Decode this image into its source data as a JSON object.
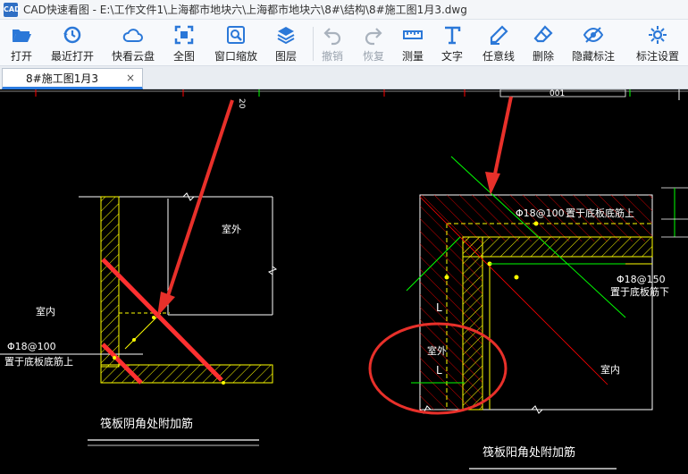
{
  "window": {
    "app_logo": "CAD",
    "title": "CAD快速看图 - E:\\工作文件1\\上海都市地块六\\上海都市地块六\\8#\\结构\\8#施工图1月3.dwg"
  },
  "toolbar": {
    "open": "打开",
    "recent": "最近打开",
    "cloud": "快看云盘",
    "full_view": "全图",
    "window_zoom": "窗口缩放",
    "layers": "图层",
    "undo": "撤销",
    "redo": "恢复",
    "measure": "测量",
    "text": "文字",
    "freeline": "任意线",
    "delete": "删除",
    "hide_annot": "隐藏标注",
    "annot_settings": "标注设置"
  },
  "tabs": [
    {
      "label": "8#施工图1月3",
      "close": "×"
    }
  ],
  "drawing": {
    "left": {
      "outdoor": "室外",
      "indoor": "室内",
      "rebar": "Φ18@100",
      "rebar_note": "置于底板底筋上",
      "title": "筏板阴角处附加筋",
      "top_dim": "20"
    },
    "right": {
      "rebar_top": "Φ18@100",
      "rebar_top_note": "置于底板底筋上",
      "rebar_mid": "Φ18@150",
      "rebar_mid_note": "置于底板筋下",
      "outdoor": "室外",
      "indoor": "室内",
      "dim_l": "L",
      "dim_l2": "L",
      "title": "筏板阳角处附加筋",
      "top_dim": "001"
    }
  },
  "colors": {
    "canvas_bg": "#000000",
    "annotation_red": "#e8302a",
    "cad_yellow": "#ffff00",
    "cad_green": "#00ff00",
    "cad_red": "#ff0000",
    "toolbar_icon": "#2b78d8",
    "tab_accent": "#2b7be0"
  }
}
